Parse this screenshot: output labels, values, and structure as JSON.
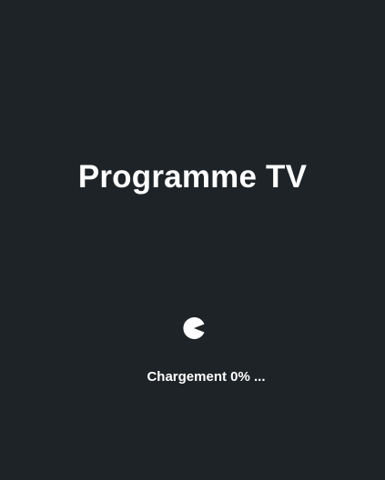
{
  "app": {
    "title": "Programme TV"
  },
  "loader": {
    "icon": "pacman-spinner-icon",
    "label": "Chargement",
    "progress_text": "0%",
    "ellipsis": "...",
    "progress_percent": 0
  },
  "colors": {
    "background": "#1e2327",
    "text": "#ffffff"
  }
}
